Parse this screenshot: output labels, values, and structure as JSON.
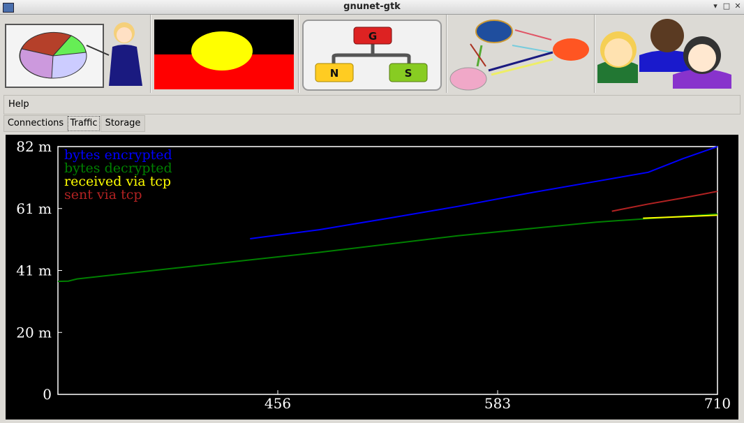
{
  "window": {
    "title": "gnunet-gtk"
  },
  "toolbar": {
    "buttons": [
      {
        "name": "statistics-button",
        "icon": "statistics-presenter-icon"
      },
      {
        "name": "peer-info-button",
        "icon": "aboriginal-flag-icon"
      },
      {
        "name": "gns-button",
        "icon": "gns-tree-icon"
      },
      {
        "name": "network-button",
        "icon": "network-nodes-icon"
      },
      {
        "name": "identity-button",
        "icon": "people-icon"
      }
    ]
  },
  "menu": {
    "help": "Help"
  },
  "tabs": [
    {
      "label": "Connections"
    },
    {
      "label": "Traffic"
    },
    {
      "label": "Storage"
    }
  ],
  "chart_data": {
    "type": "line",
    "y_ticks": [
      "82 m",
      "61 m",
      "41 m",
      "20 m",
      "0"
    ],
    "x_ticks": [
      "456",
      "583",
      "710"
    ],
    "xlim": [
      329,
      710
    ],
    "ylim": [
      0,
      82
    ],
    "series": [
      {
        "name": "bytes encrypted",
        "color": "#0000ff",
        "x": [
          440,
          480,
          520,
          560,
          600,
          640,
          670,
          690,
          710
        ],
        "y": [
          51.5,
          54.5,
          58.3,
          62.2,
          66.5,
          70.5,
          73.5,
          78.0,
          82.0
        ]
      },
      {
        "name": "bytes decrypted",
        "color": "#008000",
        "x": [
          329,
          335,
          340,
          400,
          480,
          560,
          640,
          710
        ],
        "y": [
          37.4,
          37.5,
          38.2,
          42.0,
          47.0,
          52.5,
          57.0,
          59.7
        ]
      },
      {
        "name": "received via tcp",
        "color": "#ffff00",
        "x": [
          667,
          690,
          710
        ],
        "y": [
          58.3,
          58.8,
          59.3
        ]
      },
      {
        "name": "sent via tcp",
        "color": "#b22222",
        "x": [
          649,
          655,
          670,
          690,
          710
        ],
        "y": [
          60.6,
          61.3,
          63.0,
          65.0,
          67.2
        ]
      }
    ]
  }
}
